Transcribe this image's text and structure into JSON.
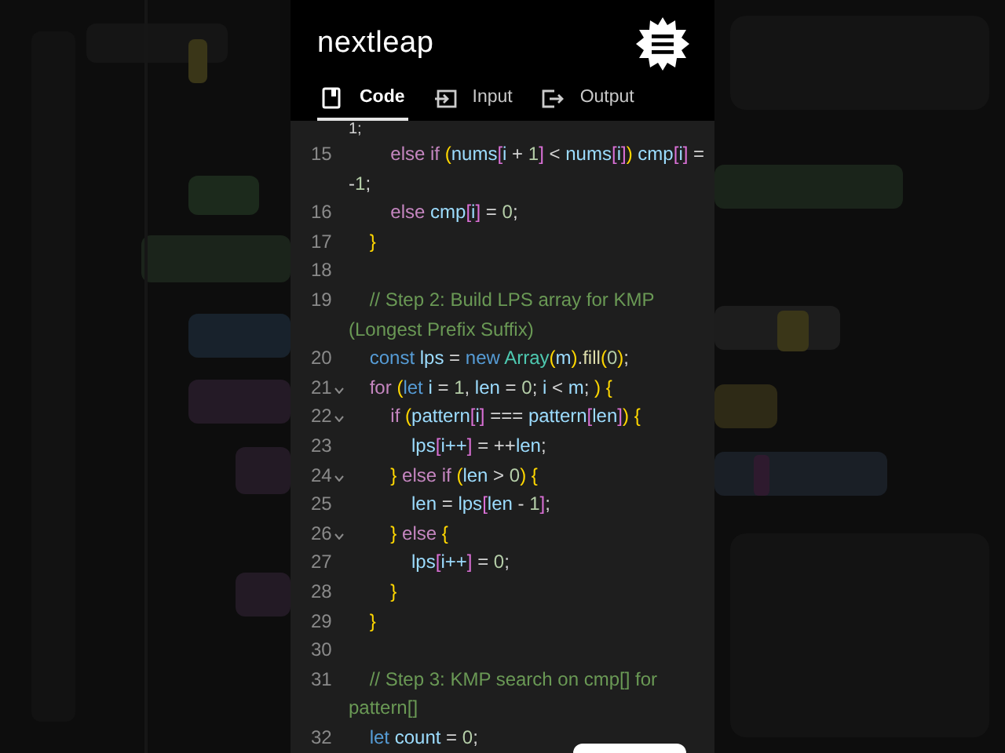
{
  "brand": {
    "logo": "nextleap"
  },
  "tabs": [
    {
      "label": "Code",
      "selected": true
    },
    {
      "label": "Input",
      "selected": false
    },
    {
      "label": "Output",
      "selected": false
    }
  ],
  "code": {
    "lines": [
      {
        "fold": false,
        "tokens": [
          {
            "kind": "op",
            "text": "1;"
          }
        ]
      },
      {
        "number": "15",
        "fold": false,
        "tokens": [
          {
            "kind": "kw",
            "text": "        else if "
          },
          {
            "kind": "p",
            "text": "("
          },
          {
            "kind": "id",
            "text": "nums"
          },
          {
            "kind": "b",
            "text": "["
          },
          {
            "kind": "id",
            "text": "i"
          },
          {
            "kind": "op",
            "text": " + "
          },
          {
            "kind": "num",
            "text": "1"
          },
          {
            "kind": "b",
            "text": "]"
          },
          {
            "kind": "op",
            "text": " < "
          },
          {
            "kind": "id",
            "text": "nums"
          },
          {
            "kind": "b",
            "text": "["
          },
          {
            "kind": "id",
            "text": "i"
          },
          {
            "kind": "b",
            "text": "]"
          },
          {
            "kind": "p",
            "text": ")"
          },
          {
            "kind": "id",
            "text": " cmp"
          },
          {
            "kind": "b",
            "text": "["
          },
          {
            "kind": "id",
            "text": "i"
          },
          {
            "kind": "b",
            "text": "]"
          },
          {
            "kind": "op",
            "text": " = -"
          },
          {
            "kind": "num",
            "text": "1"
          },
          {
            "kind": "op",
            "text": ";"
          }
        ]
      },
      {
        "number": "16",
        "fold": false,
        "tokens": [
          {
            "kind": "kw",
            "text": "        else "
          },
          {
            "kind": "id",
            "text": "cmp"
          },
          {
            "kind": "b",
            "text": "["
          },
          {
            "kind": "id",
            "text": "i"
          },
          {
            "kind": "b",
            "text": "]"
          },
          {
            "kind": "op",
            "text": " = "
          },
          {
            "kind": "num",
            "text": "0"
          },
          {
            "kind": "op",
            "text": ";"
          }
        ]
      },
      {
        "number": "17",
        "fold": false,
        "tokens": [
          {
            "kind": "p",
            "text": "    }"
          }
        ]
      },
      {
        "number": "18",
        "fold": false
      },
      {
        "number": "19",
        "fold": false,
        "tokens": [
          {
            "kind": "cm",
            "text": "    // Step 2: Build LPS array for KMP (Longest Prefix Suffix)"
          }
        ]
      },
      {
        "number": "20",
        "fold": false,
        "tokens": [
          {
            "kind": "dec",
            "text": "    const "
          },
          {
            "kind": "id",
            "text": "lps"
          },
          {
            "kind": "op",
            "text": " = "
          },
          {
            "kind": "dec",
            "text": "new "
          },
          {
            "kind": "cls",
            "text": "Array"
          },
          {
            "kind": "p",
            "text": "("
          },
          {
            "kind": "id",
            "text": "m"
          },
          {
            "kind": "p",
            "text": ")"
          },
          {
            "kind": "op",
            "text": "."
          },
          {
            "kind": "fn",
            "text": "fill"
          },
          {
            "kind": "p",
            "text": "("
          },
          {
            "kind": "num",
            "text": "0"
          },
          {
            "kind": "p",
            "text": ")"
          },
          {
            "kind": "op",
            "text": ";"
          }
        ]
      },
      {
        "number": "21",
        "fold": true,
        "tokens": [
          {
            "kind": "kw",
            "text": "    for "
          },
          {
            "kind": "p",
            "text": "("
          },
          {
            "kind": "dec",
            "text": "let "
          },
          {
            "kind": "id",
            "text": "i"
          },
          {
            "kind": "op",
            "text": " = "
          },
          {
            "kind": "num",
            "text": "1"
          },
          {
            "kind": "op",
            "text": ", "
          },
          {
            "kind": "id",
            "text": "len"
          },
          {
            "kind": "op",
            "text": " = "
          },
          {
            "kind": "num",
            "text": "0"
          },
          {
            "kind": "op",
            "text": "; "
          },
          {
            "kind": "id",
            "text": "i"
          },
          {
            "kind": "op",
            "text": " < "
          },
          {
            "kind": "id",
            "text": "m"
          },
          {
            "kind": "op",
            "text": "; "
          },
          {
            "kind": "p",
            "text": ") {"
          }
        ]
      },
      {
        "number": "22",
        "fold": true,
        "tokens": [
          {
            "kind": "kw",
            "text": "        if "
          },
          {
            "kind": "p",
            "text": "("
          },
          {
            "kind": "id",
            "text": "pattern"
          },
          {
            "kind": "b",
            "text": "["
          },
          {
            "kind": "id",
            "text": "i"
          },
          {
            "kind": "b",
            "text": "]"
          },
          {
            "kind": "op",
            "text": " === "
          },
          {
            "kind": "id",
            "text": "pattern"
          },
          {
            "kind": "b",
            "text": "["
          },
          {
            "kind": "id",
            "text": "len"
          },
          {
            "kind": "b",
            "text": "]"
          },
          {
            "kind": "p",
            "text": ") {"
          }
        ]
      },
      {
        "number": "23",
        "fold": false,
        "tokens": [
          {
            "kind": "id",
            "text": "            lps"
          },
          {
            "kind": "b",
            "text": "["
          },
          {
            "kind": "id",
            "text": "i++"
          },
          {
            "kind": "b",
            "text": "]"
          },
          {
            "kind": "op",
            "text": " = ++"
          },
          {
            "kind": "id",
            "text": "len"
          },
          {
            "kind": "op",
            "text": ";"
          }
        ]
      },
      {
        "number": "24",
        "fold": true,
        "tokens": [
          {
            "kind": "p",
            "text": "        } "
          },
          {
            "kind": "kw",
            "text": "else if "
          },
          {
            "kind": "p",
            "text": "("
          },
          {
            "kind": "id",
            "text": "len"
          },
          {
            "kind": "op",
            "text": " > "
          },
          {
            "kind": "num",
            "text": "0"
          },
          {
            "kind": "p",
            "text": ") {"
          }
        ]
      },
      {
        "number": "25",
        "fold": false,
        "tokens": [
          {
            "kind": "id",
            "text": "            len"
          },
          {
            "kind": "op",
            "text": " = "
          },
          {
            "kind": "id",
            "text": "lps"
          },
          {
            "kind": "b",
            "text": "["
          },
          {
            "kind": "id",
            "text": "len"
          },
          {
            "kind": "op",
            "text": " - "
          },
          {
            "kind": "num",
            "text": "1"
          },
          {
            "kind": "b",
            "text": "]"
          },
          {
            "kind": "op",
            "text": ";"
          }
        ]
      },
      {
        "number": "26",
        "fold": true,
        "tokens": [
          {
            "kind": "p",
            "text": "        } "
          },
          {
            "kind": "kw",
            "text": "else "
          },
          {
            "kind": "p",
            "text": "{"
          }
        ]
      },
      {
        "number": "27",
        "fold": false,
        "tokens": [
          {
            "kind": "id",
            "text": "            lps"
          },
          {
            "kind": "b",
            "text": "["
          },
          {
            "kind": "id",
            "text": "i++"
          },
          {
            "kind": "b",
            "text": "]"
          },
          {
            "kind": "op",
            "text": " = "
          },
          {
            "kind": "num",
            "text": "0"
          },
          {
            "kind": "op",
            "text": ";"
          }
        ]
      },
      {
        "number": "28",
        "fold": false,
        "tokens": [
          {
            "kind": "p",
            "text": "        }"
          }
        ]
      },
      {
        "number": "29",
        "fold": false,
        "tokens": [
          {
            "kind": "p",
            "text": "    }"
          }
        ]
      },
      {
        "number": "30",
        "fold": false
      },
      {
        "number": "31",
        "fold": false,
        "tokens": [
          {
            "kind": "cm",
            "text": "    // Step 3: KMP search on cmp[] for pattern[]"
          }
        ]
      },
      {
        "number": "32",
        "fold": false,
        "tokens": [
          {
            "kind": "dec",
            "text": "    let "
          },
          {
            "kind": "id",
            "text": "count"
          },
          {
            "kind": "op",
            "text": " = "
          },
          {
            "kind": "num",
            "text": "0"
          },
          {
            "kind": "op",
            "text": ";"
          }
        ]
      }
    ]
  }
}
